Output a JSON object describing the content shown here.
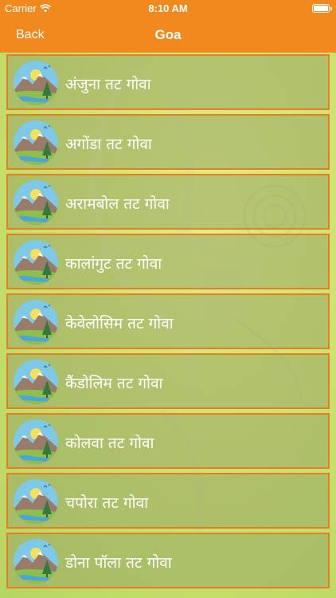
{
  "status_bar": {
    "carrier": "Carrier",
    "time": "8:10 AM",
    "battery_level": 1.0
  },
  "nav": {
    "back_label": "Back",
    "title": "Goa"
  },
  "colors": {
    "accent": "#f08a1e",
    "item_border": "#e67f22",
    "item_text": "#ffffff"
  },
  "list": {
    "thumbnail_icon": "landscape-mountain-icon",
    "items": [
      {
        "label": "अंजुना तट गोवा"
      },
      {
        "label": "अगोंडा तट गोवा"
      },
      {
        "label": "अरामबोल तट गोवा"
      },
      {
        "label": "कालांगुट तट गोवा"
      },
      {
        "label": "केवेलोसिम तट गोवा"
      },
      {
        "label": "कैंडोलिम तट गोवा"
      },
      {
        "label": "कोलवा तट गोवा"
      },
      {
        "label": "चपोरा तट गोवा"
      },
      {
        "label": "डोना पॉला तट गोवा"
      }
    ]
  }
}
